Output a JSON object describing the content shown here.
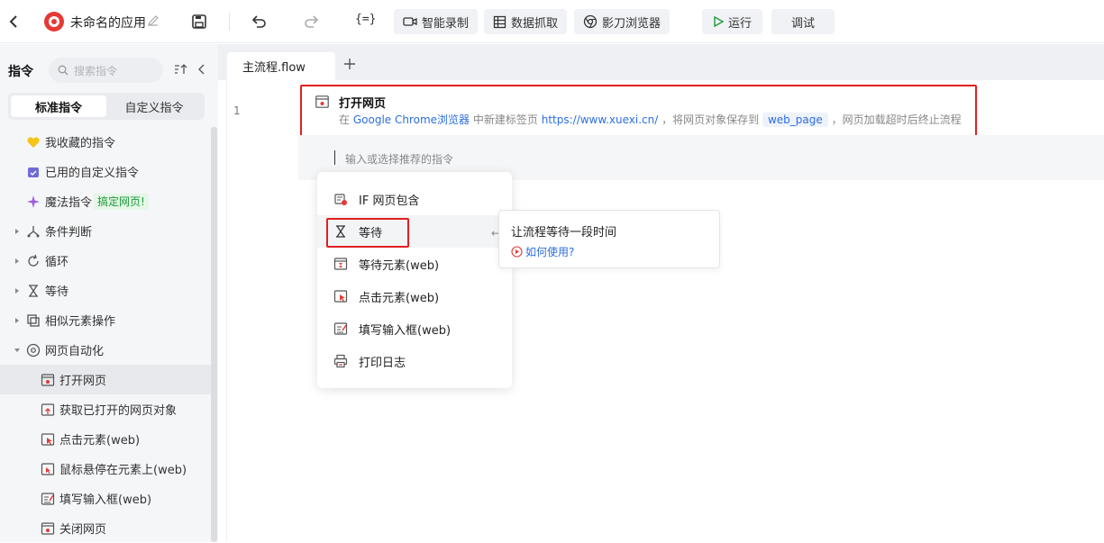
{
  "topbar": {
    "app_title": "未命名的应用",
    "buttons": {
      "record": "智能录制",
      "scrape": "数据抓取",
      "browser": "影刀浏览器",
      "run": "运行",
      "debug": "调试"
    },
    "expr_icon_text": "{=}"
  },
  "sidebar": {
    "header": "指令",
    "search_placeholder": "搜索指令",
    "tabs": [
      "标准指令",
      "自定义指令"
    ],
    "items": [
      {
        "label": "我收藏的指令",
        "icon": "heart-icon"
      },
      {
        "label": "已用的自定义指令",
        "icon": "calendar-icon"
      },
      {
        "label": "魔法指令",
        "icon": "sparkle-icon",
        "badge": "搞定网页!"
      },
      {
        "label": "条件判断",
        "icon": "branch-icon"
      },
      {
        "label": "循环",
        "icon": "loop-icon"
      },
      {
        "label": "等待",
        "icon": "hourglass-icon"
      },
      {
        "label": "相似元素操作",
        "icon": "copy-icon"
      },
      {
        "label": "网页自动化",
        "icon": "browser-icon"
      },
      {
        "label": "打开网页",
        "icon": "webpage-icon"
      },
      {
        "label": "获取已打开的网页对象",
        "icon": "webpage-up-icon"
      },
      {
        "label": "点击元素(web)",
        "icon": "click-icon"
      },
      {
        "label": "鼠标悬停在元素上(web)",
        "icon": "hover-icon"
      },
      {
        "label": "填写输入框(web)",
        "icon": "input-icon"
      },
      {
        "label": "关闭网页",
        "icon": "close-web-icon"
      }
    ]
  },
  "editor": {
    "file_tab": "主流程.flow",
    "line_number": "1",
    "step": {
      "title": "打开网页",
      "desc_prefix": "在",
      "browser": "Google Chrome浏览器",
      "desc_mid": "中新建标签页",
      "url": "https://www.xuexi.cn/",
      "desc_save": "，将网页对象保存到",
      "variable": "web_page",
      "desc_suffix": "，网页加载超时后终止流程"
    },
    "insert_placeholder": "输入或选择推荐的指令"
  },
  "dropdown": {
    "items": [
      {
        "label": "IF 网页包含",
        "icon": "if-web-icon"
      },
      {
        "label": "等待",
        "icon": "hourglass-icon"
      },
      {
        "label": "等待元素(web)",
        "icon": "wait-element-icon"
      },
      {
        "label": "点击元素(web)",
        "icon": "click-icon"
      },
      {
        "label": "填写输入框(web)",
        "icon": "input-icon"
      },
      {
        "label": "打印日志",
        "icon": "print-icon"
      }
    ]
  },
  "tooltip": {
    "title": "让流程等待一段时间",
    "link": "如何使用?"
  },
  "colors": {
    "accent_blue": "#2c6ee0",
    "highlight_red": "#e02020",
    "run_green": "#1e9a3a"
  }
}
